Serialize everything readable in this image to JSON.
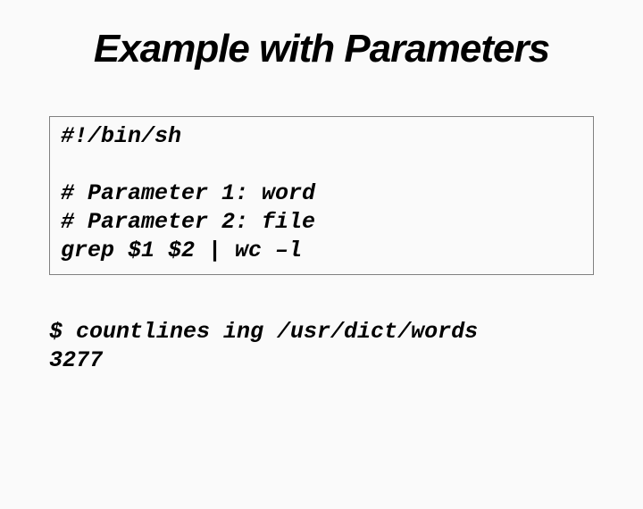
{
  "slide": {
    "title": "Example with Parameters",
    "script": {
      "line1": "#!/bin/sh",
      "line2": "# Parameter 1: word",
      "line3": "# Parameter 2: file",
      "line4": "grep $1 $2 | wc –l"
    },
    "terminal": {
      "line1": "$ countlines ing /usr/dict/words",
      "line2": "3277"
    }
  }
}
